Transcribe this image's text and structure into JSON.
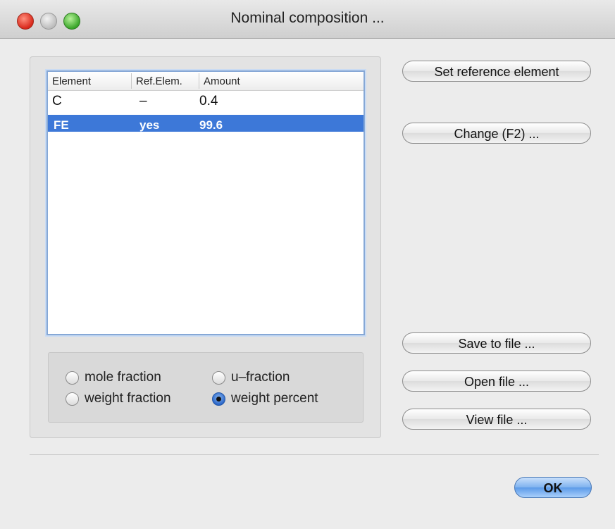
{
  "window": {
    "title": "Nominal composition ..."
  },
  "table": {
    "headers": [
      "Element",
      "Ref.Elem.",
      "Amount"
    ],
    "rows": [
      {
        "element": "C",
        "ref": "–",
        "amount": "0.4"
      },
      {
        "element": "FE",
        "ref": "yes",
        "amount": "99.6"
      }
    ],
    "selected_row": 1
  },
  "units": {
    "options": [
      "mole fraction",
      "u–fraction",
      "weight fraction",
      "weight percent"
    ],
    "selected": "weight percent"
  },
  "buttons": {
    "set_reference": "Set reference element",
    "change": "Change (F2) ...",
    "save": "Save to file ...",
    "open": "Open file ...",
    "view": "View file ...",
    "ok": "OK"
  },
  "colors": {
    "selection": "#3d78d8",
    "close": "#d9281b",
    "maximize": "#3aa62a"
  }
}
